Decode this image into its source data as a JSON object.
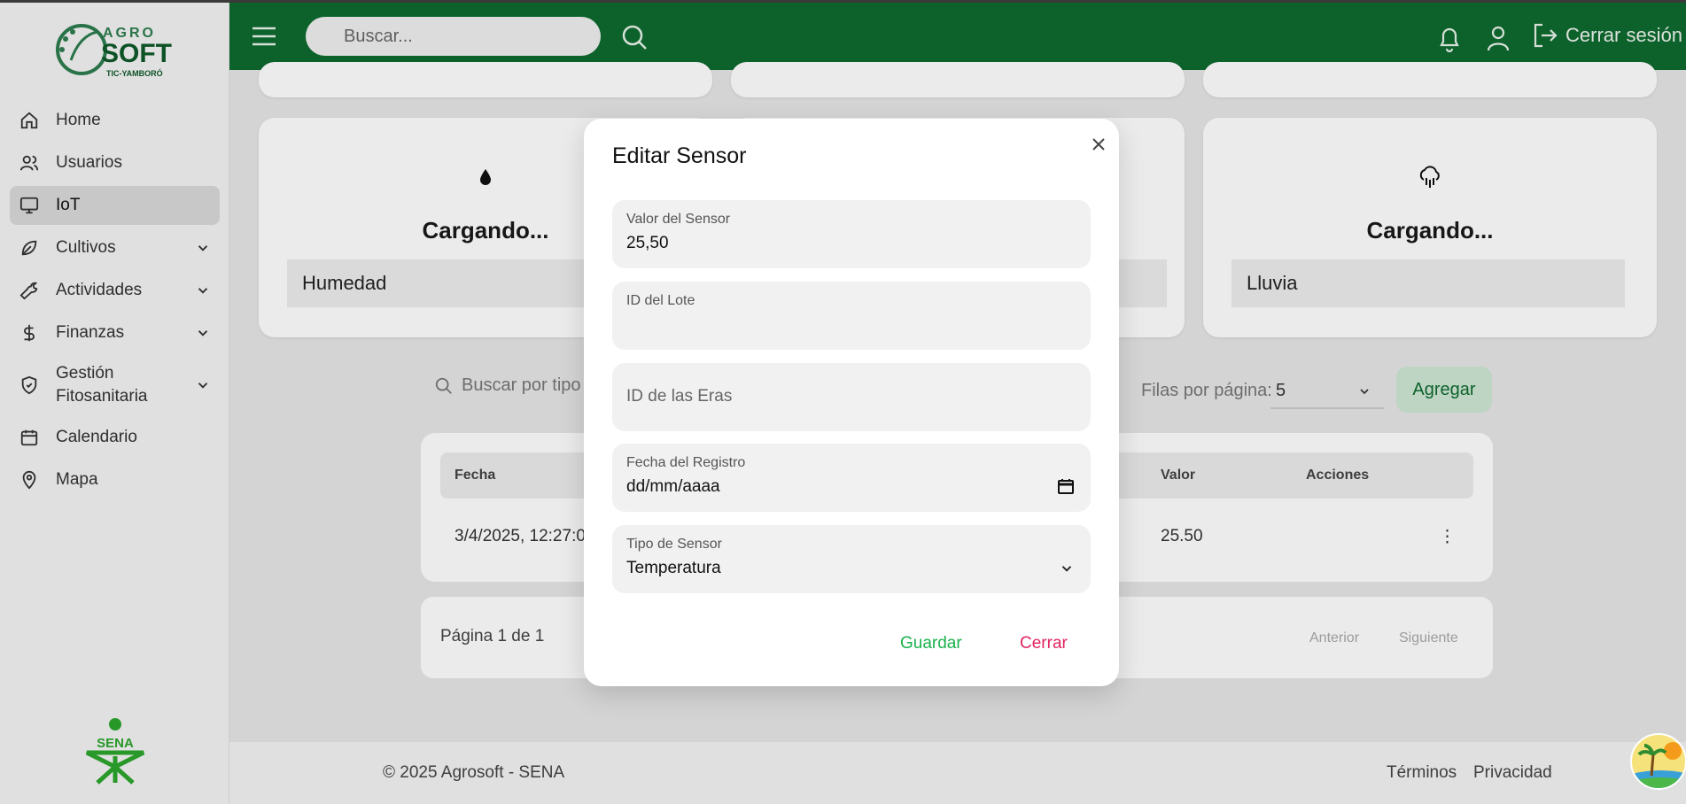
{
  "brand": {
    "logo_text": "AGRO",
    "logo_text2": "SOFT",
    "logo_sub": "TIC-YAMBORÓ",
    "sena_text": "SENA"
  },
  "sidebar": {
    "items": [
      {
        "label": "Home",
        "icon": "home-icon"
      },
      {
        "label": "Usuarios",
        "icon": "users-icon"
      },
      {
        "label": "IoT",
        "icon": "monitor-icon",
        "active": true
      },
      {
        "label": "Cultivos",
        "icon": "leaf-icon",
        "expandable": true
      },
      {
        "label": "Actividades",
        "icon": "wrench-icon",
        "expandable": true
      },
      {
        "label": "Finanzas",
        "icon": "dollar-icon",
        "expandable": true
      },
      {
        "label": "Gestión Fitosanitaria",
        "icon": "shield-icon",
        "expandable": true
      },
      {
        "label": "Calendario",
        "icon": "calendar-icon"
      },
      {
        "label": "Mapa",
        "icon": "map-pin-icon"
      }
    ]
  },
  "header": {
    "search_placeholder": "Buscar...",
    "logout_label": "Cerrar sesión"
  },
  "cards": [
    {
      "title": "Cargando...",
      "label": "Humedad",
      "icon": "droplet-icon"
    },
    {
      "title": "Cargando...",
      "label": "Lluvia",
      "icon": "cloud-rain-icon"
    }
  ],
  "table": {
    "search_placeholder": "Buscar por tipo",
    "rows_per_page_label": "Filas por página:",
    "rows_per_page_value": "5",
    "add_label": "Agregar",
    "headers": {
      "fecha": "Fecha",
      "valor": "Valor",
      "acciones": "Acciones"
    },
    "rows": [
      {
        "fecha": "3/4/2025, 12:27:0",
        "valor": "25.50"
      }
    ],
    "page_info": "Página 1 de 1",
    "prev_label": "Anterior",
    "next_label": "Siguiente"
  },
  "footer": {
    "copyright": "© 2025 Agrosoft - SENA",
    "terms": "Términos",
    "privacy": "Privacidad"
  },
  "modal": {
    "title": "Editar Sensor",
    "fields": {
      "valor": {
        "label": "Valor del Sensor",
        "value": "25,50"
      },
      "lote": {
        "label": "ID del Lote",
        "value": ""
      },
      "eras": {
        "placeholder": "ID de las Eras"
      },
      "fecha": {
        "label": "Fecha del Registro",
        "value": "dd/mm/aaaa"
      },
      "tipo": {
        "label": "Tipo de Sensor",
        "value": "Temperatura"
      }
    },
    "save_label": "Guardar",
    "close_label": "Cerrar"
  },
  "colors": {
    "header_green": "#0f6b2f",
    "save_green": "#19b24b",
    "close_pink": "#e0245e",
    "add_button_bg": "#cfe8d5"
  }
}
